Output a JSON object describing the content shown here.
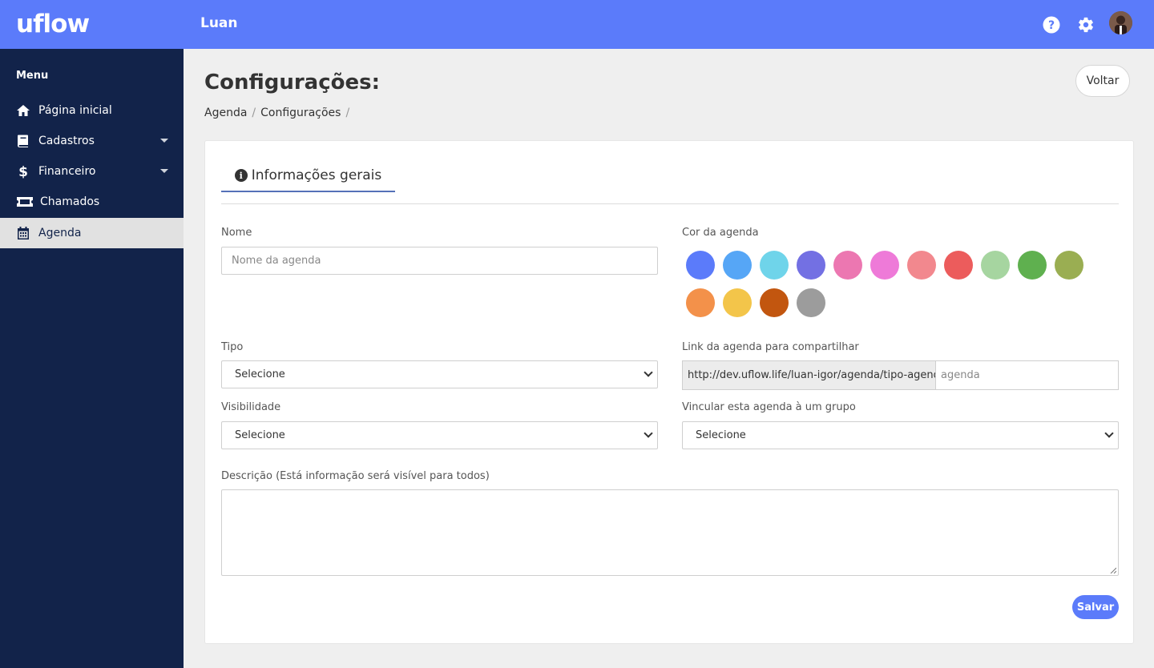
{
  "app": {
    "logo": "uflow",
    "user_name": "Luan"
  },
  "header_icons": [
    "help-icon",
    "gear-icon",
    "avatar"
  ],
  "sidebar": {
    "menu_title": "Menu",
    "items": [
      {
        "label": "Página inicial",
        "icon": "home-icon",
        "has_caret": false,
        "active": false
      },
      {
        "label": "Cadastros",
        "icon": "book-icon",
        "has_caret": true,
        "active": false
      },
      {
        "label": "Financeiro",
        "icon": "dollar-icon",
        "has_caret": true,
        "active": false
      },
      {
        "label": "Chamados",
        "icon": "ticket-icon",
        "has_caret": false,
        "active": false
      },
      {
        "label": "Agenda",
        "icon": "calendar-icon",
        "has_caret": false,
        "active": true
      }
    ]
  },
  "page": {
    "title": "Configurações:",
    "breadcrumb": [
      "Agenda",
      "Configurações"
    ],
    "back_label": "Voltar"
  },
  "tabs": [
    {
      "label": "Informações gerais",
      "icon": "info-icon",
      "active": true
    }
  ],
  "form": {
    "nome": {
      "label": "Nome",
      "placeholder": "Nome da agenda"
    },
    "cor": {
      "label": "Cor da agenda",
      "colors": [
        "#5b7bfa",
        "#56a6f6",
        "#6fd4ea",
        "#7370e3",
        "#ec77b1",
        "#ee7ad8",
        "#f2888e",
        "#ec5c5c",
        "#a6d5a0",
        "#5fb04f",
        "#9aae52",
        "#f3914a",
        "#f3c54a",
        "#c2560f",
        "#9c9c9c"
      ]
    },
    "tipo": {
      "label": "Tipo",
      "value": "Selecione"
    },
    "link": {
      "label": "Link da agenda para compartilhar",
      "prefix": "http://dev.uflow.life/luan-igor/agenda/tipo-agenda/",
      "placeholder": "agenda"
    },
    "visibilidade": {
      "label": "Visibilidade",
      "value": "Selecione"
    },
    "grupo": {
      "label": "Vincular esta agenda à um grupo",
      "value": "Selecione"
    },
    "descricao": {
      "label": "Descrição (Está informação será visível para todos)",
      "value": ""
    },
    "save_label": "Salvar"
  },
  "colors": {
    "accent": "#5b7bfa",
    "sidebar": "#12234a",
    "background": "#efefef"
  }
}
